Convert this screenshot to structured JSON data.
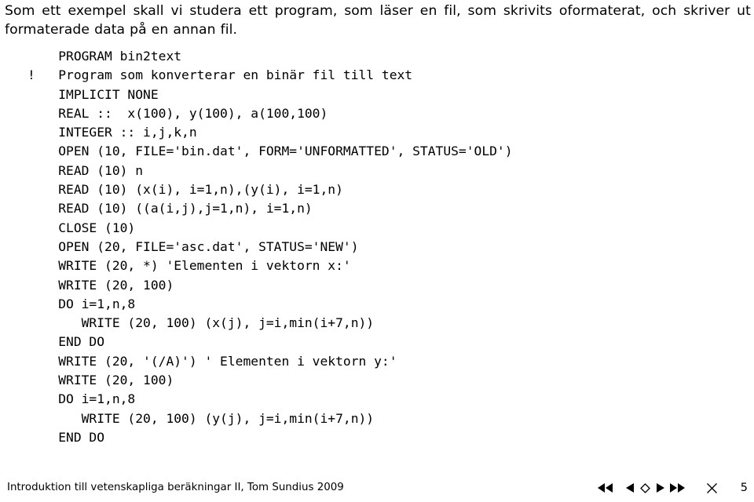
{
  "slide": {
    "intro": {
      "line1": "Som ett exempel skall vi studera ett program, som läser en fil, som skrivits oformaterat, och skriver ut",
      "line2": "formaterade data på en annan fil."
    },
    "code": {
      "language": "Fortran",
      "lines": [
        "    PROGRAM bin2text",
        "!   Program som konverterar en binär fil till text",
        "    IMPLICIT NONE",
        "    REAL ::  x(100), y(100), a(100,100)",
        "    INTEGER :: i,j,k,n",
        "    OPEN (10, FILE='bin.dat', FORM='UNFORMATTED', STATUS='OLD')",
        "    READ (10) n",
        "    READ (10) (x(i), i=1,n),(y(i), i=1,n)",
        "    READ (10) ((a(i,j),j=1,n), i=1,n)",
        "    CLOSE (10)",
        "    OPEN (20, FILE='asc.dat', STATUS='NEW')",
        "    WRITE (20, *) 'Elementen i vektorn x:'",
        "    WRITE (20, 100)",
        "    DO i=1,n,8",
        "       WRITE (20, 100) (x(j), j=i,min(i+7,n))",
        "    END DO",
        "    WRITE (20, '(/A)') ' Elementen i vektorn y:'",
        "    WRITE (20, 100)",
        "    DO i=1,n,8",
        "       WRITE (20, 100) (y(j), j=i,min(i+7,n))",
        "    END DO"
      ]
    },
    "footer": {
      "credit": "Introduktion till vetenskapliga beräkningar II, Tom Sundius 2009",
      "page_number": "5",
      "nav": {
        "first_label": "first-slide",
        "prev_label": "previous-slide",
        "marker_label": "current-position",
        "next_label": "next-slide",
        "last_label": "last-slide",
        "close_label": "close"
      }
    }
  }
}
